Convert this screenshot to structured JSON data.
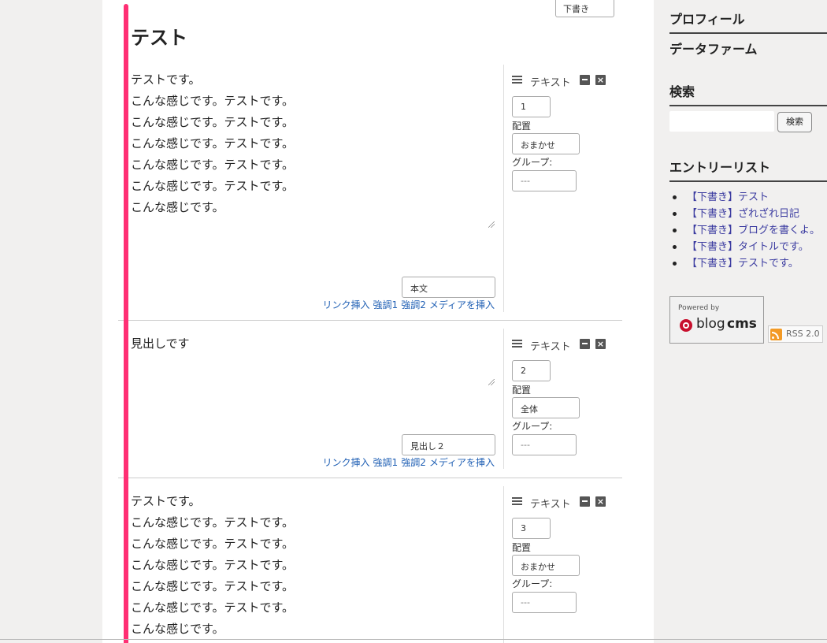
{
  "editor": {
    "status_value": "下書き",
    "entry_title": "テスト",
    "units": [
      {
        "lines": [
          "テストです。",
          "こんな感じです。テストです。",
          "こんな感じです。テストです。",
          "こんな感じです。テストです。",
          "こんな感じです。テストです。",
          "こんな感じです。テストです。",
          "こんな感じです。"
        ],
        "type_value": "本文",
        "panel_label": "テキスト",
        "order": "1",
        "align_label": "配置",
        "align_value": "おまかせ",
        "group_label": "グループ:",
        "group_value": "---"
      },
      {
        "lines": [
          "見出しです"
        ],
        "type_value": "見出し２",
        "panel_label": "テキスト",
        "order": "2",
        "align_label": "配置",
        "align_value": "全体",
        "group_label": "グループ:",
        "group_value": "---"
      },
      {
        "lines": [
          "テストです。",
          "こんな感じです。テストです。",
          "こんな感じです。テストです。",
          "こんな感じです。テストです。",
          "こんな感じです。テストです。",
          "こんな感じです。テストです。",
          "こんな感じです。"
        ],
        "panel_label": "テキスト",
        "order": "3",
        "align_label": "配置",
        "align_value": "おまかせ",
        "group_label": "グループ:",
        "group_value": "---"
      }
    ],
    "toolbar": {
      "link_insert": "リンク挿入",
      "emphasis1": "強調1",
      "emphasis2": "強調2",
      "media_insert": "メディアを挿入"
    }
  },
  "sidebar": {
    "profile_title": "プロフィール",
    "data_farm_title": "データファーム",
    "search_title": "検索",
    "search_button": "検索",
    "entry_list_title": "エントリーリスト",
    "entries": [
      "【下書き】テスト",
      "【下書き】ざれざれ日記",
      "【下書き】ブログを書くよ。",
      "【下書き】タイトルです。",
      "【下書き】テストです。"
    ],
    "powered_by": "Powered by",
    "logo_blog": "blog",
    "logo_cms": "cms",
    "rss_label": "RSS 2.0"
  },
  "colors": {
    "accent_bar": "#ff2f74",
    "link": "#1f5fb4",
    "entry_link": "#3b3ba0"
  },
  "icons": [
    "hamburger-icon",
    "minimize-icon",
    "close-icon",
    "rss-icon",
    "acms-logo-icon"
  ]
}
